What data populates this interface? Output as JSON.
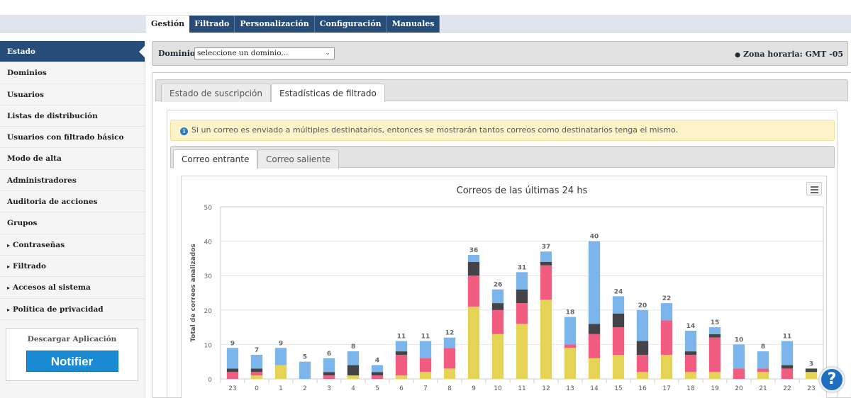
{
  "top_tabs": [
    {
      "label": "Gestión",
      "active": true
    },
    {
      "label": "Filtrado",
      "active": false
    },
    {
      "label": "Personalización",
      "active": false
    },
    {
      "label": "Configuración",
      "active": false
    },
    {
      "label": "Manuales",
      "active": false
    }
  ],
  "sidebar": {
    "items": [
      {
        "label": "Estado",
        "active": true,
        "caret": ""
      },
      {
        "label": "Dominios",
        "caret": ""
      },
      {
        "label": "Usuarios",
        "caret": ""
      },
      {
        "label": "Listas de distribución",
        "caret": ""
      },
      {
        "label": "Usuarios con filtrado básico",
        "caret": ""
      },
      {
        "label": "Modo de alta",
        "caret": ""
      },
      {
        "label": "Administradores",
        "caret": ""
      },
      {
        "label": "Auditoria de acciones",
        "caret": ""
      },
      {
        "label": "Grupos",
        "caret": ""
      },
      {
        "label": "Contraseñas",
        "caret": "▸"
      },
      {
        "label": "Filtrado",
        "caret": "▸"
      },
      {
        "label": "Accesos al sistema",
        "caret": "▸"
      },
      {
        "label": "Política de privacidad",
        "caret": "▸"
      }
    ],
    "download": {
      "title": "Descargar Aplicación",
      "button": "Notifier"
    }
  },
  "domain_bar": {
    "label": "Dominio:",
    "select_value": "seleccione un dominio...",
    "timezone": "Zona horaria: GMT -05"
  },
  "main_tabs": [
    {
      "label": "Estado de suscripción",
      "active": false
    },
    {
      "label": "Estadísticas de filtrado",
      "active": true
    }
  ],
  "alert": "Si un correo es enviado a múltiples destinatarios, entonces se mostrarán tantos correos como destinatarios tenga el mismo.",
  "chart_tabs": [
    {
      "label": "Correo entrante",
      "active": true
    },
    {
      "label": "Correo saliente",
      "active": false
    }
  ],
  "colors": {
    "yellow": "#e4d354",
    "pink": "#f15c80",
    "dark": "#434348",
    "blue": "#7cb5ec",
    "nav": "#274c78"
  },
  "chart_data": {
    "type": "bar",
    "stacked": true,
    "title": "Correos de las últimas 24 hs",
    "ylabel": "Total de correos analizados",
    "ylim": [
      0,
      50
    ],
    "yticks": [
      0,
      10,
      20,
      30,
      40,
      50
    ],
    "grid": true,
    "categories": [
      "23",
      "0",
      "1",
      "2",
      "3",
      "4",
      "5",
      "6",
      "7",
      "8",
      "9",
      "10",
      "11",
      "12",
      "13",
      "14",
      "15",
      "16",
      "17",
      "18",
      "19",
      "20",
      "21",
      "22",
      "23"
    ],
    "totals": [
      9,
      7,
      9,
      5,
      6,
      8,
      4,
      11,
      11,
      12,
      36,
      26,
      31,
      37,
      18,
      40,
      24,
      20,
      22,
      14,
      15,
      10,
      8,
      11,
      3
    ],
    "series": [
      {
        "color": "#e4d354",
        "values": [
          0,
          1,
          4,
          0,
          0,
          1,
          0,
          1,
          2,
          3,
          21,
          13,
          16,
          23,
          9,
          6,
          7,
          2,
          7,
          2,
          2,
          0,
          2,
          0,
          2
        ]
      },
      {
        "color": "#f15c80",
        "values": [
          2,
          1,
          0,
          0,
          1,
          0,
          1,
          6,
          4,
          6,
          9,
          7,
          6,
          10,
          1,
          7,
          8,
          5,
          10,
          5,
          10,
          3,
          1,
          3,
          0
        ]
      },
      {
        "color": "#434348",
        "values": [
          1,
          1,
          0,
          0,
          1,
          3,
          1,
          1,
          0,
          0,
          4,
          2,
          4,
          1,
          0,
          3,
          4,
          4,
          0,
          1,
          1,
          0,
          0,
          1,
          1
        ]
      },
      {
        "color": "#7cb5ec",
        "values": [
          6,
          4,
          5,
          5,
          4,
          4,
          2,
          3,
          5,
          3,
          2,
          4,
          5,
          3,
          8,
          24,
          5,
          9,
          5,
          6,
          2,
          7,
          5,
          7,
          0
        ]
      }
    ]
  }
}
